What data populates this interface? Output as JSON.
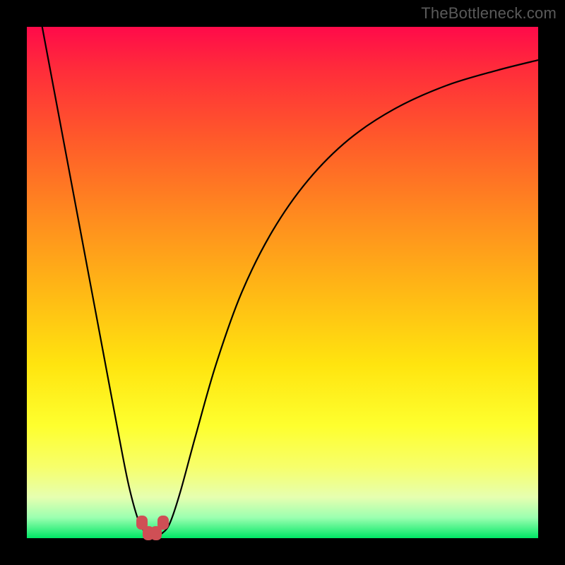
{
  "watermark": "TheBottleneck.com",
  "colors": {
    "page_bg": "#000000",
    "gradient_top": "#ff0a4a",
    "gradient_bottom": "#00e765",
    "curve_stroke": "#000000",
    "marker_fill": "#cf4f55",
    "watermark_text": "#5a5a5a"
  },
  "chart_data": {
    "type": "line",
    "title": "",
    "xlabel": "",
    "ylabel": "",
    "xlim": [
      0,
      100
    ],
    "ylim": [
      0,
      100
    ],
    "x": [
      3,
      6,
      9,
      12,
      15,
      18,
      20,
      22,
      23.5,
      25,
      26.5,
      28,
      30,
      33,
      37,
      42,
      48,
      55,
      63,
      72,
      82,
      92,
      100
    ],
    "values": [
      100,
      84,
      68,
      52,
      36,
      20,
      10,
      3,
      1,
      0.5,
      1,
      3,
      9,
      20,
      34,
      48,
      60,
      70,
      78,
      84,
      88.5,
      91.5,
      93.5
    ],
    "markers": [
      {
        "x": 22.5,
        "y": 3
      },
      {
        "x": 23.8,
        "y": 1
      },
      {
        "x": 25.3,
        "y": 1
      },
      {
        "x": 26.6,
        "y": 3
      }
    ],
    "note": "x and y are in percent of the plotting area; y=0 at bottom, y=100 at top; values estimated from gridless gradient chart"
  }
}
